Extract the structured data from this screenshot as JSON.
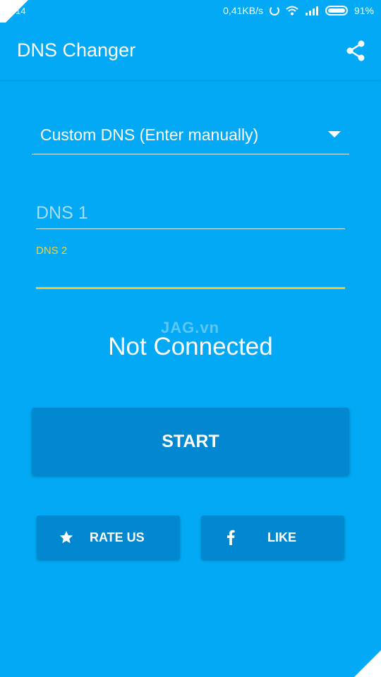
{
  "status_bar": {
    "clock": "14",
    "net_speed": "0,41KB/s",
    "battery": "91%",
    "icons": [
      "sync-icon",
      "wifi-icon",
      "signal-icon",
      "battery-icon"
    ]
  },
  "app_bar": {
    "title": "DNS Changer",
    "share_icon": "share-icon"
  },
  "dns_selector": {
    "selected": "Custom DNS (Enter manually)",
    "icon": "dropdown-arrow-icon"
  },
  "fields": {
    "dns1_placeholder": "DNS 1",
    "dns1_value": "",
    "dns2_label": "DNS 2",
    "dns2_value": ""
  },
  "status": {
    "text": "Not Connected",
    "watermark": "JAG.vn"
  },
  "buttons": {
    "start_label": "START",
    "rate_label": "RATE US",
    "rate_icon": "star-icon",
    "like_label": "LIKE",
    "like_icon": "facebook-icon"
  },
  "colors": {
    "background": "#03A9F4",
    "button": "#0288D1",
    "accent": "#F4C430"
  }
}
